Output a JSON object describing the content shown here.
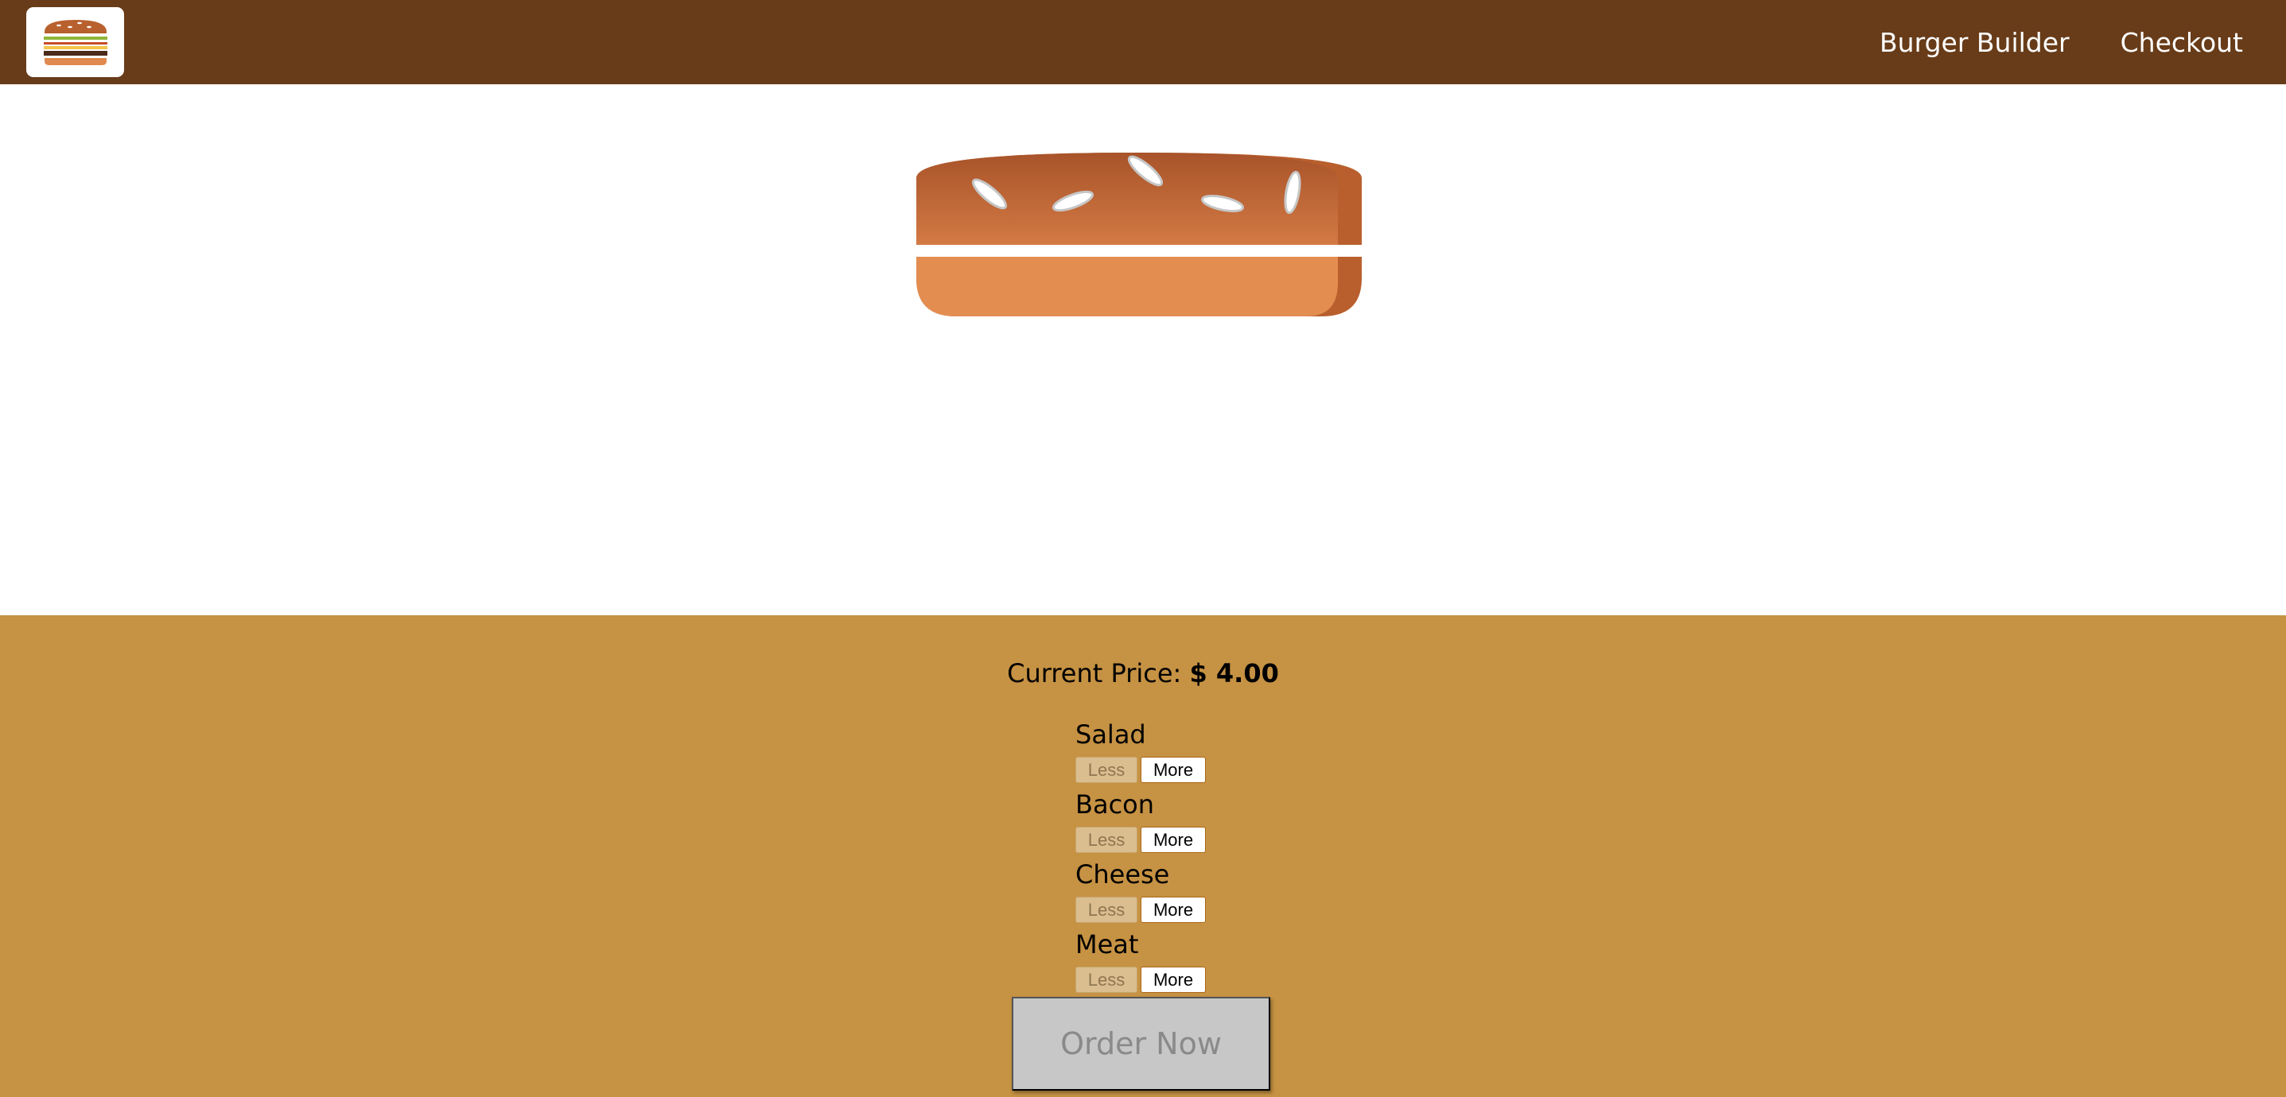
{
  "toolbar": {
    "logo_icon": "burger-logo-icon",
    "nav": [
      {
        "label": "Burger Builder"
      },
      {
        "label": "Checkout"
      }
    ]
  },
  "build_controls": {
    "price_label": "Current Price: ",
    "price_value": "$ 4.00",
    "controls": [
      {
        "label": "Salad",
        "less": "Less",
        "more": "More"
      },
      {
        "label": "Bacon",
        "less": "Less",
        "more": "More"
      },
      {
        "label": "Cheese",
        "less": "Less",
        "more": "More"
      },
      {
        "label": "Meat",
        "less": "Less",
        "more": "More"
      }
    ],
    "order_button": "Order Now"
  },
  "colors": {
    "toolbar_bg": "#683c19",
    "controls_bg": "#c69243",
    "bun_dark": "#b85f2d",
    "bun_light": "#e38d50"
  }
}
